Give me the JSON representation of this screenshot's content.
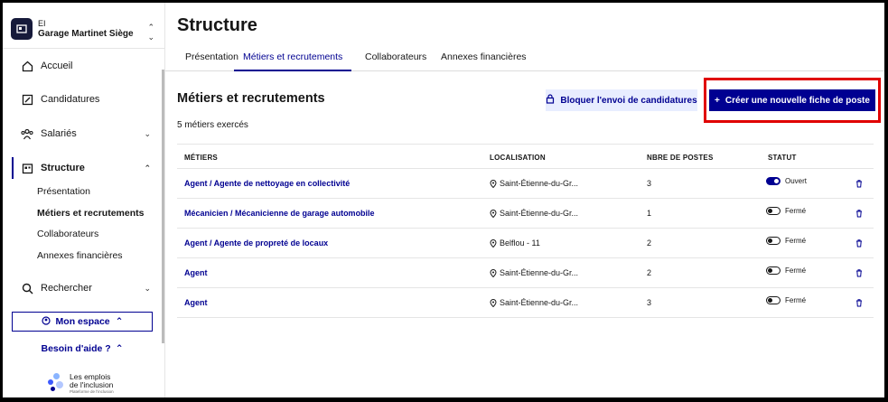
{
  "org": {
    "type": "EI",
    "name": "Garage Martinet Siège"
  },
  "sidebar": {
    "items": [
      {
        "label": "Accueil",
        "icon": "home-icon"
      },
      {
        "label": "Candidatures",
        "icon": "edit-document-icon"
      },
      {
        "label": "Salariés",
        "icon": "team-icon"
      },
      {
        "label": "Structure",
        "icon": "building-icon"
      },
      {
        "label": "Rechercher",
        "icon": "search-icon"
      }
    ],
    "structure_sub": [
      "Présentation",
      "Métiers et recrutements",
      "Collaborateurs",
      "Annexes financières"
    ],
    "espace_label": "Mon espace",
    "help_label": "Besoin d'aide ?",
    "brand_line1": "Les emplois",
    "brand_line2": "de l'inclusion",
    "brand_tagline": "Plateforme de l'inclusion"
  },
  "main": {
    "title": "Structure",
    "tabs": [
      "Présentation",
      "Métiers et recrutements",
      "Collaborateurs",
      "Annexes financières"
    ],
    "section_title": "Métiers et recrutements",
    "count_text": "5 métiers exercés",
    "block_button": "Bloquer l'envoi de candidatures",
    "create_button": "Créer une nouvelle fiche de poste"
  },
  "table": {
    "headers": [
      "MÉTIERS",
      "LOCALISATION",
      "NBRE DE POSTES",
      "STATUT"
    ],
    "rows": [
      {
        "job": "Agent / Agente de nettoyage en collectivité",
        "location": "Saint-Étienne-du-Gr...",
        "positions": "3",
        "status": "Ouvert",
        "open": true
      },
      {
        "job": "Mécanicien / Mécanicienne de garage automobile",
        "location": "Saint-Étienne-du-Gr...",
        "positions": "1",
        "status": "Fermé",
        "open": false
      },
      {
        "job": "Agent / Agente de propreté de locaux",
        "location": "Belflou - 11",
        "positions": "2",
        "status": "Fermé",
        "open": false
      },
      {
        "job": "Agent",
        "location": "Saint-Étienne-du-Gr...",
        "positions": "2",
        "status": "Fermé",
        "open": false
      },
      {
        "job": "Agent",
        "location": "Saint-Étienne-du-Gr...",
        "positions": "3",
        "status": "Fermé",
        "open": false
      }
    ]
  },
  "colors": {
    "primary": "#000091",
    "highlight": "#e00000",
    "secondary_bg": "#e8edff"
  }
}
